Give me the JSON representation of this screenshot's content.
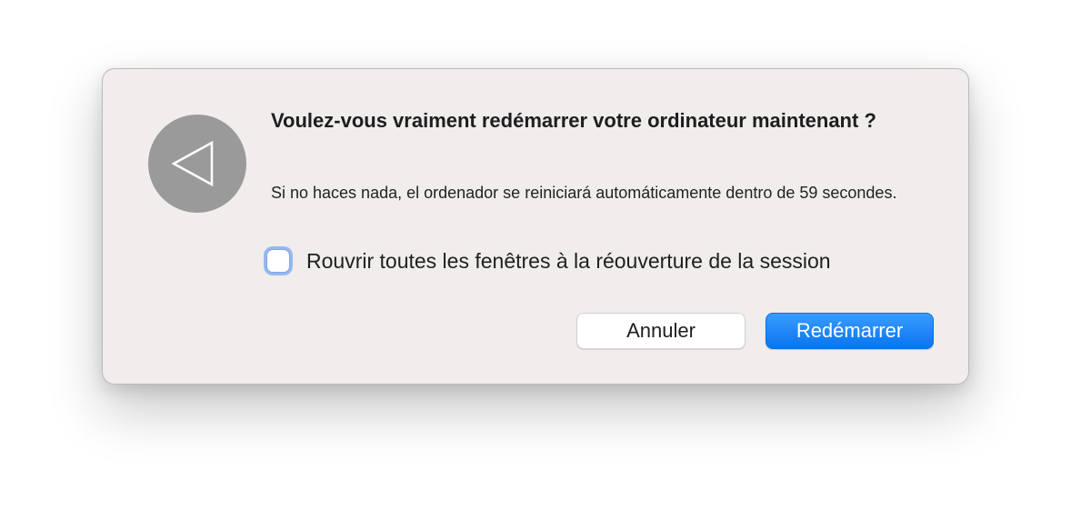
{
  "dialog": {
    "icon": "back-arrow-icon",
    "title": "Voulez-vous vraiment redémarrer votre ordinateur maintenant ?",
    "message": "Si no haces nada, el ordenador se reiniciará automáticamente dentro de 59 secondes.",
    "checkbox": {
      "label": "Rouvrir toutes les fenêtres à la réouverture de la session",
      "checked": false
    },
    "buttons": {
      "cancel_label": "Annuler",
      "confirm_label": "Redémarrer"
    },
    "colors": {
      "background": "#f0edec",
      "accent": "#0a74f0",
      "icon_circle": "#9b9a9a"
    }
  }
}
